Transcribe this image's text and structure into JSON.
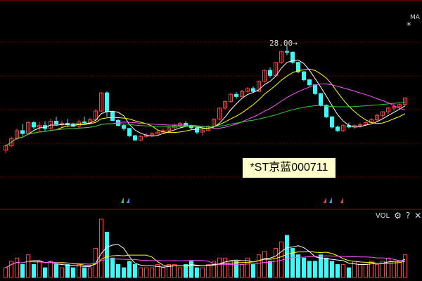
{
  "header": {
    "ma_label": "MA",
    "ma_star": "*"
  },
  "price_chart": {
    "peak_label": "28.00"
  },
  "stock_tag": {
    "label": "*ST京蓝000711"
  },
  "volume_panel": {
    "label": "VOL",
    "settings_icon": "gear-icon",
    "help_icon": "question-icon",
    "close_icon": "close-icon",
    "settings_glyph": "⚙",
    "help_glyph": "?",
    "close_glyph": "✕"
  },
  "colors": {
    "up": "#ff3c3c",
    "down": "#33ffff",
    "ma5": "#ffffff",
    "ma10": "#ffff00",
    "ma20": "#ff55ff",
    "ma60": "#33cc33",
    "grid": "#7a0000",
    "separator": "#aa0000"
  },
  "chart_data": {
    "type": "candlestick",
    "price_max_label": 28.0,
    "ohlc": [
      [
        13.6,
        14.4,
        13.2,
        14.2
      ],
      [
        14.2,
        15.5,
        14.0,
        15.2
      ],
      [
        15.2,
        16.6,
        15.0,
        16.3
      ],
      [
        16.3,
        17.2,
        15.6,
        15.9
      ],
      [
        15.9,
        17.6,
        15.7,
        17.4
      ],
      [
        17.4,
        17.6,
        16.5,
        16.8
      ],
      [
        16.8,
        17.5,
        16.2,
        17.0
      ],
      [
        17.0,
        17.6,
        16.3,
        16.6
      ],
      [
        16.6,
        17.9,
        16.4,
        17.6
      ],
      [
        17.6,
        18.2,
        17.0,
        17.2
      ],
      [
        17.2,
        17.7,
        16.7,
        17.3
      ],
      [
        17.3,
        17.9,
        16.8,
        17.1
      ],
      [
        17.1,
        17.4,
        16.8,
        16.9
      ],
      [
        16.9,
        17.8,
        16.7,
        17.5
      ],
      [
        17.5,
        18.2,
        17.1,
        17.4
      ],
      [
        17.4,
        18.1,
        17.2,
        17.8
      ],
      [
        17.8,
        19.3,
        17.6,
        19.0
      ],
      [
        19.0,
        21.6,
        18.8,
        21.5
      ],
      [
        21.5,
        21.7,
        18.2,
        18.9
      ],
      [
        18.9,
        19.0,
        17.6,
        17.7
      ],
      [
        17.7,
        17.9,
        16.9,
        17.0
      ],
      [
        17.0,
        17.2,
        16.3,
        16.6
      ],
      [
        16.6,
        16.7,
        15.4,
        15.6
      ],
      [
        15.6,
        15.7,
        14.9,
        15.0
      ],
      [
        15.0,
        15.7,
        14.8,
        15.5
      ],
      [
        15.5,
        16.0,
        15.3,
        15.7
      ],
      [
        15.7,
        16.1,
        15.5,
        15.9
      ],
      [
        15.9,
        16.4,
        15.7,
        16.1
      ],
      [
        16.1,
        16.6,
        15.9,
        16.3
      ],
      [
        16.3,
        16.9,
        16.0,
        16.7
      ],
      [
        16.7,
        17.3,
        16.5,
        17.0
      ],
      [
        17.0,
        17.5,
        16.8,
        17.3
      ],
      [
        17.3,
        17.6,
        16.9,
        17.0
      ],
      [
        17.0,
        17.1,
        16.4,
        16.7
      ],
      [
        16.7,
        16.8,
        15.8,
        16.1
      ],
      [
        16.1,
        16.5,
        15.6,
        16.3
      ],
      [
        16.3,
        17.0,
        16.2,
        16.9
      ],
      [
        16.9,
        18.0,
        16.8,
        17.9
      ],
      [
        17.9,
        19.5,
        17.7,
        19.4
      ],
      [
        19.4,
        20.5,
        19.2,
        20.3
      ],
      [
        20.3,
        21.5,
        20.1,
        21.3
      ],
      [
        21.3,
        21.6,
        20.7,
        21.0
      ],
      [
        21.0,
        21.9,
        20.9,
        21.7
      ],
      [
        21.7,
        22.3,
        21.5,
        22.1
      ],
      [
        22.1,
        22.4,
        21.5,
        21.7
      ],
      [
        21.7,
        23.2,
        21.6,
        23.1
      ],
      [
        23.1,
        24.7,
        22.9,
        24.6
      ],
      [
        24.6,
        25.0,
        23.6,
        23.9
      ],
      [
        23.9,
        25.8,
        23.8,
        25.7
      ],
      [
        25.7,
        27.3,
        25.5,
        27.2
      ],
      [
        27.2,
        28.0,
        26.7,
        27.1
      ],
      [
        27.1,
        27.2,
        25.5,
        25.7
      ],
      [
        25.7,
        25.8,
        24.2,
        24.4
      ],
      [
        24.4,
        24.5,
        23.1,
        23.3
      ],
      [
        23.3,
        23.4,
        22.4,
        22.6
      ],
      [
        22.6,
        22.7,
        21.2,
        21.4
      ],
      [
        21.4,
        21.5,
        19.6,
        19.8
      ],
      [
        19.8,
        19.9,
        18.0,
        18.2
      ],
      [
        18.2,
        18.3,
        16.6,
        16.8
      ],
      [
        16.8,
        17.0,
        16.1,
        16.3
      ],
      [
        16.3,
        17.2,
        16.1,
        17.0
      ],
      [
        17.0,
        17.4,
        16.6,
        16.8
      ],
      [
        16.8,
        17.2,
        16.5,
        17.0
      ],
      [
        17.0,
        17.4,
        16.7,
        17.1
      ],
      [
        17.1,
        17.6,
        16.9,
        17.4
      ],
      [
        17.4,
        18.0,
        17.2,
        17.8
      ],
      [
        17.8,
        18.6,
        17.6,
        18.4
      ],
      [
        18.4,
        19.0,
        18.0,
        18.9
      ],
      [
        18.9,
        19.6,
        18.6,
        19.4
      ],
      [
        19.4,
        20.0,
        19.0,
        19.6
      ],
      [
        19.6,
        20.1,
        19.3,
        19.9
      ],
      [
        19.9,
        20.9,
        19.7,
        20.8
      ]
    ],
    "volume": [
      3,
      5,
      6,
      4,
      7,
      4,
      5,
      3,
      5,
      4,
      3,
      4,
      3,
      4,
      3,
      3,
      9,
      18,
      14,
      6,
      4,
      3,
      5,
      4,
      3,
      3,
      3,
      4,
      3,
      4,
      4,
      3,
      4,
      5,
      3,
      3,
      4,
      5,
      6,
      6,
      5,
      5,
      4,
      6,
      4,
      7,
      8,
      5,
      9,
      11,
      13,
      9,
      7,
      6,
      5,
      5,
      7,
      6,
      5,
      4,
      4,
      3,
      5,
      4,
      4,
      5,
      4,
      5,
      6,
      5,
      5,
      7
    ]
  }
}
